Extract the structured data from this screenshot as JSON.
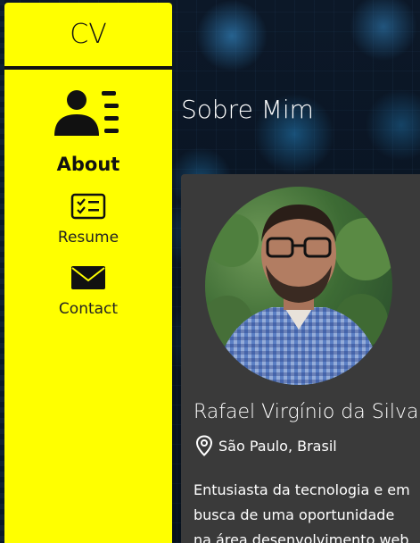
{
  "sidebar": {
    "brand": "CV",
    "items": [
      {
        "label": "About",
        "icon": "user-list-icon",
        "active": true
      },
      {
        "label": "Resume",
        "icon": "checklist-icon",
        "active": false
      },
      {
        "label": "Contact",
        "icon": "envelope-icon",
        "active": false
      }
    ]
  },
  "main": {
    "title": "Sobre Mim",
    "profile": {
      "name": "Rafael Virgínio da Silva",
      "location": "São Paulo, Brasil",
      "bio": "Entusiasta da tecnologia e em busca de uma oportunidade na área desenvolvimento web"
    }
  },
  "colors": {
    "sidebar_bg": "#ffff00",
    "card_bg": "#3a3a3a",
    "text_light": "#ffffff",
    "text_dark": "#111111"
  }
}
